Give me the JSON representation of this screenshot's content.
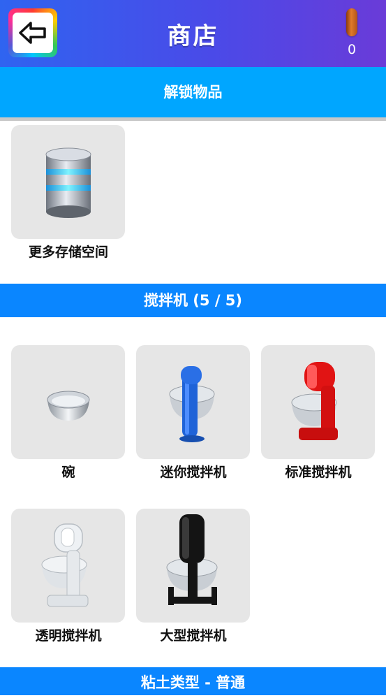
{
  "header": {
    "title": "商店",
    "coin_count": "0"
  },
  "sections": {
    "unlock": {
      "title": "解锁物品",
      "items": [
        {
          "label": "更多存储空间"
        }
      ]
    },
    "mixer": {
      "title": "搅拌机  (5 / 5)",
      "items": [
        {
          "label": "碗"
        },
        {
          "label": "迷你搅拌机"
        },
        {
          "label": "标准搅拌机"
        },
        {
          "label": "透明搅拌机"
        },
        {
          "label": "大型搅拌机"
        }
      ]
    },
    "clay": {
      "title": "粘土类型 - 普通"
    }
  },
  "colors": {
    "header_start": "#2f64f0",
    "header_end": "#6a3bd8",
    "section_light": "#00a6ff",
    "section_blue": "#0a86ff",
    "card_bg": "#e6e6e6"
  },
  "icons": [
    "back-arrow-icon",
    "coin-icon",
    "storage-icon",
    "bowl-icon",
    "mini-mixer-icon",
    "standard-mixer-icon",
    "transparent-mixer-icon",
    "large-mixer-icon"
  ]
}
